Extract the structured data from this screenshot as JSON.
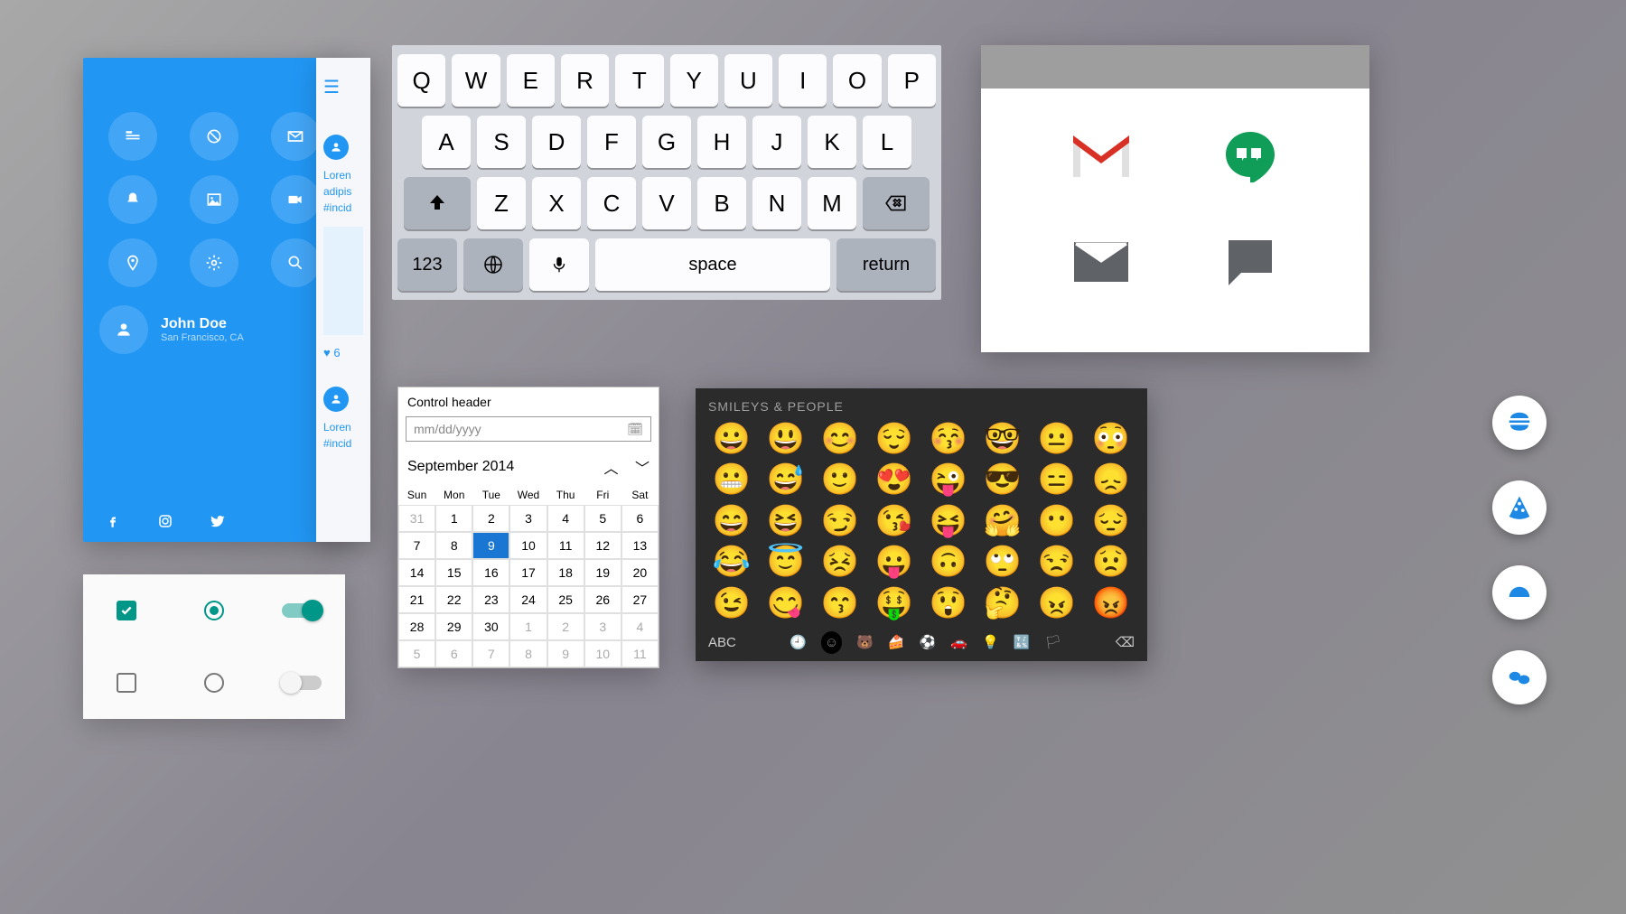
{
  "blue_panel": {
    "icons": [
      "feed",
      "block",
      "mail",
      "bell",
      "image",
      "video",
      "pin",
      "gear",
      "search"
    ],
    "profile_name": "John Doe",
    "profile_loc": "San Francisco, CA",
    "social": [
      "facebook",
      "instagram",
      "twitter"
    ]
  },
  "feed": {
    "line1": "Loren",
    "line2": "adipis",
    "line3": "#incid",
    "likes": "6"
  },
  "keyboard": {
    "row1": [
      "Q",
      "W",
      "E",
      "R",
      "T",
      "Y",
      "U",
      "I",
      "O",
      "P"
    ],
    "row2": [
      "A",
      "S",
      "D",
      "F",
      "G",
      "H",
      "J",
      "K",
      "L"
    ],
    "row3": [
      "Z",
      "X",
      "C",
      "V",
      "B",
      "N",
      "M"
    ],
    "numbers": "123",
    "space": "space",
    "return": "return"
  },
  "apps": [
    "gmail",
    "hangouts",
    "email",
    "messages"
  ],
  "calendar": {
    "header": "Control header",
    "placeholder": "mm/dd/yyyy",
    "month": "September 2014",
    "dow": [
      "Sun",
      "Mon",
      "Tue",
      "Wed",
      "Thu",
      "Fri",
      "Sat"
    ],
    "leading": [
      "31"
    ],
    "days": [
      "1",
      "2",
      "3",
      "4",
      "5",
      "6",
      "7",
      "8",
      "9",
      "10",
      "11",
      "12",
      "13",
      "14",
      "15",
      "16",
      "17",
      "18",
      "19",
      "20",
      "21",
      "22",
      "23",
      "24",
      "25",
      "26",
      "27",
      "28",
      "29",
      "30"
    ],
    "trailing": [
      "1",
      "2",
      "3",
      "4",
      "5",
      "6",
      "7",
      "8",
      "9",
      "10",
      "11"
    ],
    "selected": "9"
  },
  "emoji": {
    "title": "SMILEYS & PEOPLE",
    "grid": [
      "😀",
      "😃",
      "😊",
      "😌",
      "😚",
      "🤓",
      "😐",
      "😳",
      "😬",
      "😅",
      "🙂",
      "😍",
      "😜",
      "😎",
      "😑",
      "😞",
      "😄",
      "😆",
      "😏",
      "😘",
      "😝",
      "🤗",
      "😶",
      "😔",
      "😂",
      "😇",
      "😣",
      "😛",
      "🙃",
      "🙄",
      "😒",
      "😟",
      "😉",
      "😋",
      "😙",
      "🤑",
      "😲",
      "🤔",
      "😠",
      "😡"
    ],
    "abc": "ABC"
  },
  "fabs": [
    "burger",
    "pizza",
    "dome",
    "sushi"
  ]
}
